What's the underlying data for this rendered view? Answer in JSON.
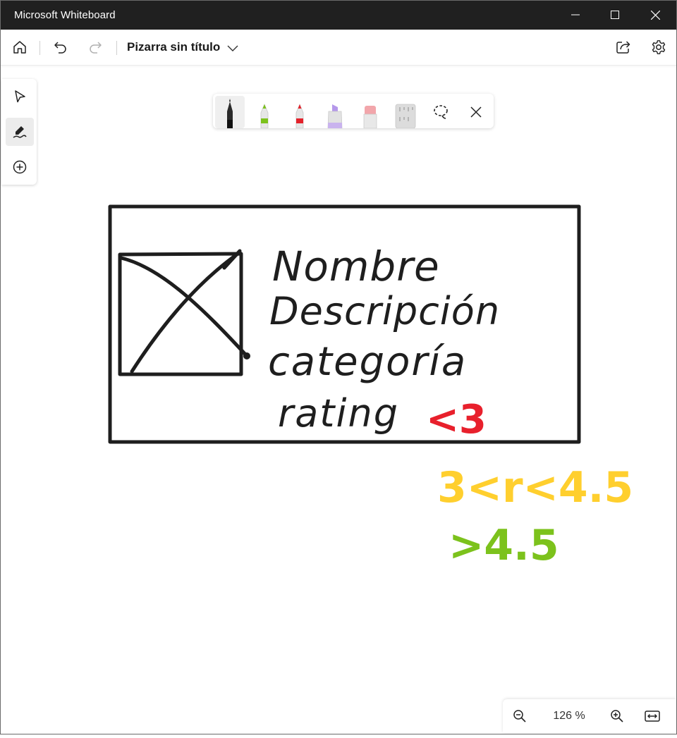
{
  "window": {
    "title": "Microsoft Whiteboard",
    "controls": [
      "minimize-icon",
      "maximize-icon",
      "close-icon"
    ]
  },
  "header": {
    "board_title": "Pizarra sin título",
    "buttons": [
      "home-icon",
      "undo-icon",
      "redo-icon",
      "share-icon",
      "settings-icon"
    ]
  },
  "rail": {
    "tools": [
      {
        "name": "select-tool",
        "icon": "pointer-icon",
        "active": false
      },
      {
        "name": "inking-tool",
        "icon": "pen-scribble-icon",
        "active": true
      },
      {
        "name": "add-tool",
        "icon": "plus-circle-icon",
        "active": false
      }
    ]
  },
  "pen_tray": {
    "tools": [
      {
        "name": "black-pen",
        "color": "#222222",
        "active": true
      },
      {
        "name": "green-pen",
        "color": "#7cc21c"
      },
      {
        "name": "red-pen",
        "color": "#e3222b"
      },
      {
        "name": "purple-highlighter",
        "color": "#c9b3ee"
      },
      {
        "name": "eraser",
        "color": "#f2a6ab"
      },
      {
        "name": "ruler",
        "color": "#d8d8d8"
      },
      {
        "name": "lasso",
        "icon": "lasso-icon"
      },
      {
        "name": "close",
        "icon": "close-icon"
      }
    ]
  },
  "canvas": {
    "ink_text": {
      "line1": "Nombre",
      "line2": "Descripción",
      "line3": "categoría",
      "line4": "rating",
      "red_note": "<3",
      "yellow_note": "3<r<4.5",
      "green_note": ">4.5"
    },
    "colors": {
      "ink_black": "#1e1e1e",
      "ink_red": "#e8202c",
      "ink_yellow": "#ffcf2e",
      "ink_green": "#7cc21c"
    }
  },
  "zoom": {
    "value": "126 %",
    "buttons": [
      "zoom-out-icon",
      "zoom-in-icon",
      "fit-to-screen-icon"
    ]
  }
}
